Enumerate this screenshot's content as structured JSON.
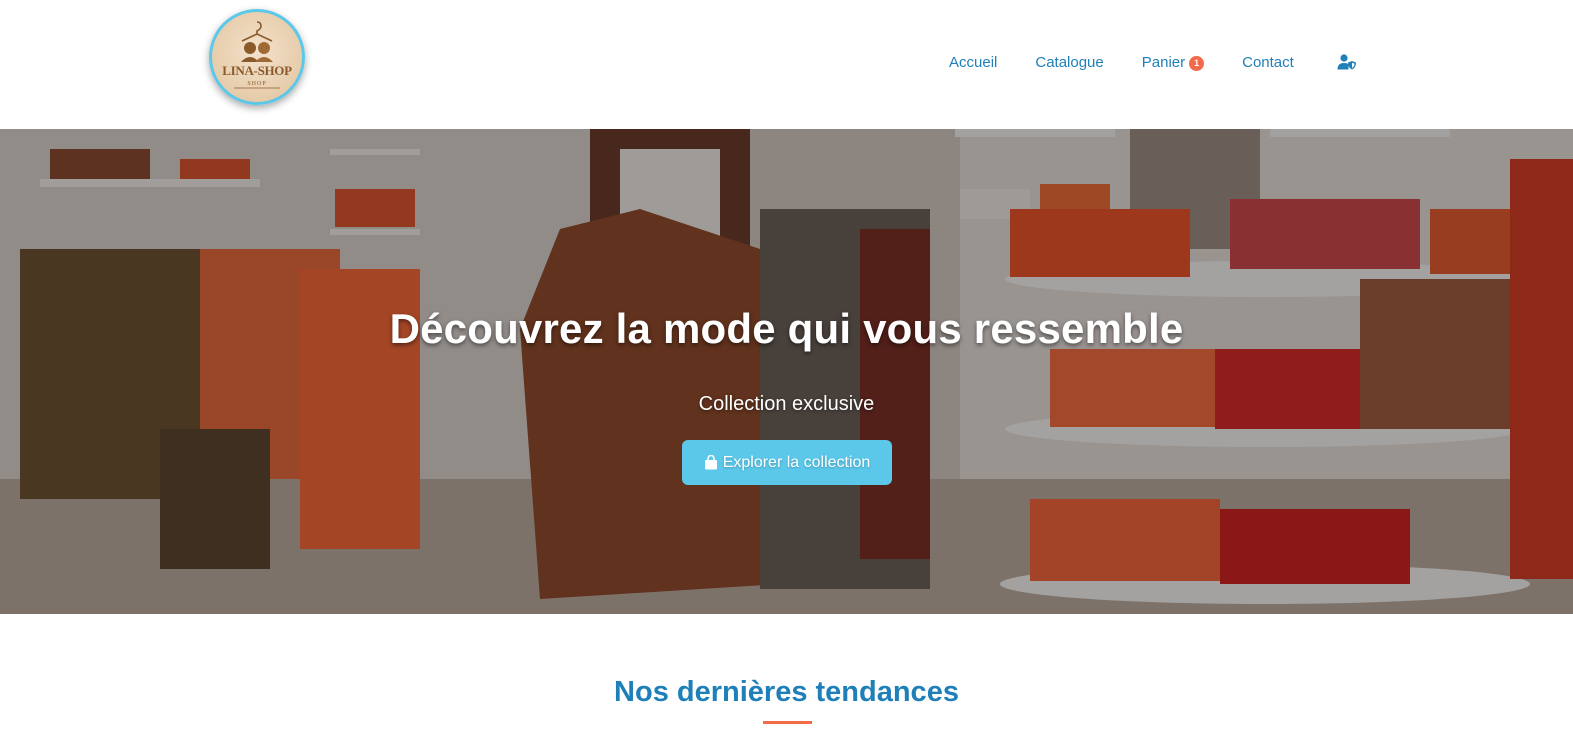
{
  "brand": {
    "logo_text": "LINA-SHOP",
    "logo_subtext": "SHOP",
    "accent_color": "#5bc8ea",
    "link_color": "#1f7fb8",
    "highlight_color": "#f26a4a"
  },
  "nav": {
    "items": [
      {
        "label": "Accueil"
      },
      {
        "label": "Catalogue"
      },
      {
        "label": "Panier",
        "badge": "1"
      },
      {
        "label": "Contact"
      }
    ],
    "account_icon": "user-shield-icon"
  },
  "hero": {
    "title": "Découvrez la mode qui vous ressemble",
    "subtitle": "Collection exclusive",
    "button_label": "Explorer la collection",
    "button_icon": "shopping-bag-icon"
  },
  "section": {
    "title": "Nos dernières tendances"
  }
}
